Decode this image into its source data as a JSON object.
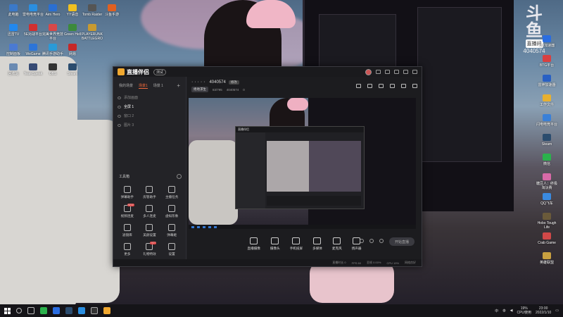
{
  "wallpaper_logo": {
    "big": "斗鱼",
    "tag": "直播间",
    "room": "4040574"
  },
  "desktop_left": [
    {
      "label": "此电脑",
      "color": "#3b79c8"
    },
    {
      "label": "雷电电竞平台",
      "color": "#2a8ee0"
    },
    {
      "label": "Aim Hero",
      "color": "#2a6fd2"
    },
    {
      "label": "YY语音",
      "color": "#f0c020"
    },
    {
      "label": "Tomb Raider",
      "color": "#555"
    },
    {
      "label": "斗鱼手游",
      "color": "#e06020"
    },
    {
      "label": "迅雷TV",
      "color": "#2288ee"
    },
    {
      "label": "5E对战平台",
      "color": "#d03030"
    },
    {
      "label": "完美世界竞技平台",
      "color": "#d84848"
    },
    {
      "label": "Green Hell",
      "color": "#3c8a3c"
    },
    {
      "label": "PLAYERUNK BATTLEGRO",
      "color": "#c89a30"
    },
    {
      "label": "控制面板",
      "color": "#4a7ad2"
    },
    {
      "label": "WeGame",
      "color": "#2d75d8"
    },
    {
      "label": "腾讯手游助手",
      "color": "#2a9ad8"
    },
    {
      "label": "网易",
      "color": "#c62828"
    },
    {
      "label": "回收站",
      "color": "#6a8ab2"
    },
    {
      "label": "TeamSpeak",
      "color": "#364a74"
    },
    {
      "label": "OBS",
      "color": "#333"
    },
    {
      "label": "Steam",
      "color": "#2b4c6e"
    }
  ],
  "desktop_right": [
    {
      "label": "UU加速器",
      "color": "#2a6de0"
    },
    {
      "label": "BTG平台",
      "color": "#d84040"
    },
    {
      "label": "雷神加速器",
      "color": "#2860c4"
    },
    {
      "label": "工作文件",
      "color": "#e8b030"
    },
    {
      "label": "闪电电竞平台",
      "color": "#3a80d8"
    },
    {
      "label": "Steam",
      "color": "#2b4c6e"
    },
    {
      "label": "微信",
      "color": "#2bb24c"
    },
    {
      "label": "糖豆人：终极淘汰赛",
      "color": "#d86aa8"
    },
    {
      "label": "QQ飞车",
      "color": "#3a8ae0"
    },
    {
      "label": "Hobo Tough Life",
      "color": "#6a5a3a"
    },
    {
      "label": "Crab Game",
      "color": "#d04848"
    },
    {
      "label": "英雄联盟",
      "color": "#c8a040"
    }
  ],
  "app": {
    "title": "直播伴侣",
    "version": "测试",
    "tabs": [
      "我的场景",
      "场景1",
      "场景 1"
    ],
    "sources": [
      "添加画面",
      "全屏 1",
      "窗口 2",
      "图片 3"
    ],
    "tools_title": "工具箱",
    "tools": [
      {
        "label": "弹幕助手"
      },
      {
        "label": "房管助手"
      },
      {
        "label": "主播任务"
      },
      {
        "label": "视频连麦",
        "badge": "NEW"
      },
      {
        "label": "多人连麦"
      },
      {
        "label": "虚拟形象"
      },
      {
        "label": "滤镜库"
      },
      {
        "label": "美颜设置"
      },
      {
        "label": "弹幕姬"
      },
      {
        "label": "更多"
      },
      {
        "label": "礼物特效",
        "badge": "HOT"
      },
      {
        "label": "设置"
      }
    ],
    "hint": "如何把手机画面投屏到电脑？",
    "room": {
      "dots": "· · · · ·",
      "id": "4040574",
      "edit": "修改",
      "category": "绝地求生",
      "viewers": "83/795",
      "fans": "4040574",
      "hot": "0"
    },
    "controls": [
      "直播摄像",
      "摄像头",
      "手机投屏",
      "多媒体",
      "麦克风",
      "扬声器"
    ],
    "live_button": "开始直播",
    "status": [
      "直播时长 0",
      "FPS 60",
      "丢帧 0.00%",
      "CPU 19%",
      "网络良好"
    ]
  },
  "taskbar": {
    "cpu_pct": "19%",
    "cpu_label": "CPU使用",
    "time": "23:00",
    "date": "2022/1/10",
    "tray_text": "中"
  }
}
